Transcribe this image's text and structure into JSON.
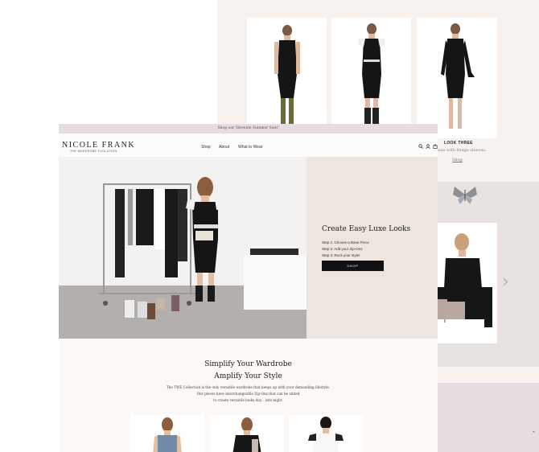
{
  "background_page": {
    "product_label": "LOOK THREE",
    "product_note": "Luxe with fringe sleeves.",
    "shop_link": "Shop",
    "next_arrow": "›",
    "footer_label": "«"
  },
  "front_page": {
    "announcement": "Shop our Sitewide Summer Sale!",
    "logo": {
      "name": "NICOLE FRANK",
      "tagline": "THE WARDROBE EVOLUTION"
    },
    "nav": [
      "Shop",
      "About",
      "What to Wear"
    ],
    "header_icons": [
      "search-icon",
      "account-icon",
      "cart-icon"
    ],
    "hero": {
      "title": "Create Easy Luxe Looks",
      "steps": [
        "Step 1: Choose a Base Piece",
        "Step 2: Add your Zip-Ons",
        "Step 3: Rock your style!"
      ],
      "button": "SHOP"
    },
    "section": {
      "title_line1": "Simplify Your Wardrobe",
      "title_line2": "Amplify Your Style",
      "body_line1": "The TWE Collection is the only versatile wardrobe that keeps up with your demanding lifestyle.",
      "body_line2": "Our pieces have interchangeable Zip-Ons that can be added",
      "body_line3": "to create versatile looks day... into night."
    }
  },
  "colors": {
    "accent_pink": "#e6dce2",
    "button_black": "#111111",
    "page_cream": "#fbf8f5",
    "back_page": "#f7f2ee"
  }
}
